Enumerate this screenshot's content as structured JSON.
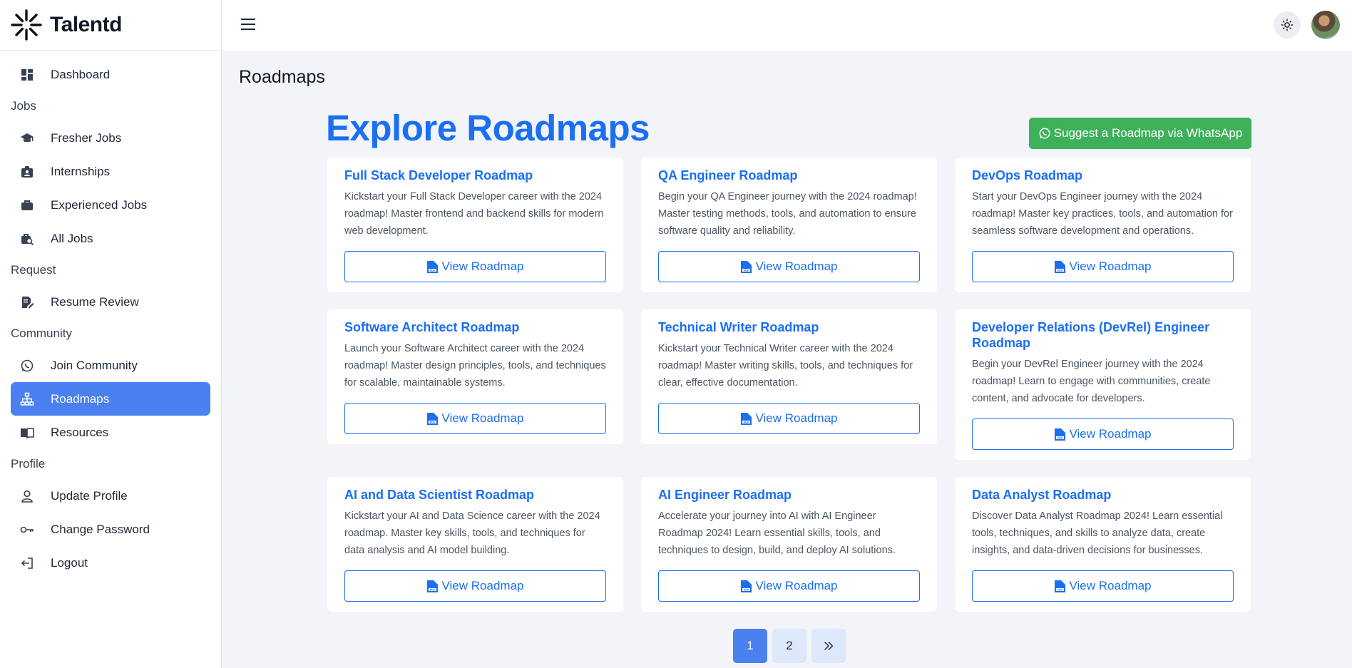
{
  "app": {
    "name": "Talentd"
  },
  "sidebar": {
    "dashboard": "Dashboard",
    "sections": {
      "jobs": "Jobs",
      "request": "Request",
      "community": "Community",
      "profile": "Profile"
    },
    "items": {
      "fresher_jobs": "Fresher Jobs",
      "internships": "Internships",
      "experienced_jobs": "Experienced Jobs",
      "all_jobs": "All Jobs",
      "resume_review": "Resume Review",
      "join_community": "Join Community",
      "roadmaps": "Roadmaps",
      "resources": "Resources",
      "update_profile": "Update Profile",
      "change_password": "Change Password",
      "logout": "Logout"
    },
    "active": "roadmaps"
  },
  "page": {
    "title": "Roadmaps",
    "hero_title": "Explore Roadmaps",
    "whatsapp_button": "Suggest a Roadmap via WhatsApp"
  },
  "cards": [
    {
      "title": "Full Stack Developer Roadmap",
      "desc": "Kickstart your Full Stack Developer career with the 2024 roadmap! Master frontend and backend skills for modern web development.",
      "button": "View Roadmap"
    },
    {
      "title": "QA Engineer Roadmap",
      "desc": "Begin your QA Engineer journey with the 2024 roadmap! Master testing methods, tools, and automation to ensure software quality and reliability.",
      "button": "View Roadmap"
    },
    {
      "title": "DevOps Roadmap",
      "desc": "Start your DevOps Engineer journey with the 2024 roadmap! Master key practices, tools, and automation for seamless software development and operations.",
      "button": "View Roadmap"
    },
    {
      "title": "Software Architect Roadmap",
      "desc": "Launch your Software Architect career with the 2024 roadmap! Master design principles, tools, and techniques for scalable, maintainable systems.",
      "button": "View Roadmap"
    },
    {
      "title": "Technical Writer Roadmap",
      "desc": "Kickstart your Technical Writer career with the 2024 roadmap! Master writing skills, tools, and techniques for clear, effective documentation.",
      "button": "View Roadmap"
    },
    {
      "title": "Developer Relations (DevRel) Engineer Roadmap",
      "desc": "Begin your DevRel Engineer journey with the 2024 roadmap! Learn to engage with communities, create content, and advocate for developers.",
      "button": "View Roadmap"
    },
    {
      "title": "AI and Data Scientist Roadmap",
      "desc": "Kickstart your AI and Data Science career with the 2024 roadmap. Master key skills, tools, and techniques for data analysis and AI model building.",
      "button": "View Roadmap"
    },
    {
      "title": "AI Engineer Roadmap",
      "desc": "Accelerate your journey into AI with AI Engineer Roadmap 2024! Learn essential skills, tools, and techniques to design, build, and deploy AI solutions.",
      "button": "View Roadmap"
    },
    {
      "title": "Data Analyst Roadmap",
      "desc": "Discover Data Analyst Roadmap 2024! Learn essential tools, techniques, and skills to analyze data, create insights, and data-driven decisions for businesses.",
      "button": "View Roadmap"
    }
  ],
  "pagination": {
    "page1": "1",
    "page2": "2",
    "next_icon": "double-chevron-right-icon",
    "current": 1
  },
  "colors": {
    "accent": "#1b6ff0",
    "active_nav": "#4a80f0",
    "whatsapp": "#3fb05a"
  }
}
